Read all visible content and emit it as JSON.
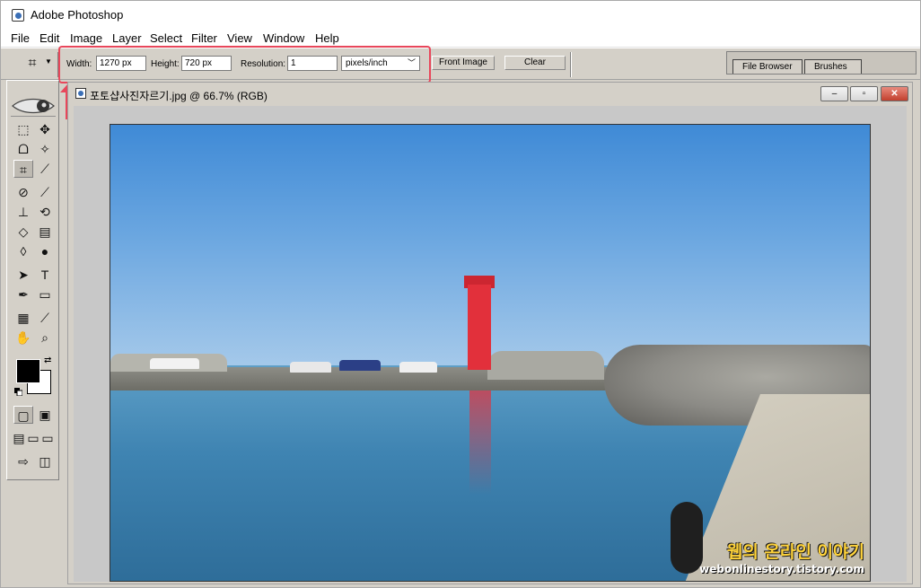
{
  "app": {
    "title": "Adobe Photoshop"
  },
  "menu": [
    "File",
    "Edit",
    "Image",
    "Layer",
    "Select",
    "Filter",
    "View",
    "Window",
    "Help"
  ],
  "options": {
    "width_label": "Width:",
    "width_value": "1270 px",
    "height_label": "Height:",
    "height_value": "720 px",
    "resolution_label": "Resolution:",
    "resolution_value": "1",
    "resolution_unit": "pixels/inch",
    "front_image_label": "Front Image",
    "clear_label": "Clear"
  },
  "palette_well": {
    "tabs": [
      "File Browser",
      "Brushes"
    ]
  },
  "document": {
    "title": "포토샵사진자르기.jpg @ 66.7% (RGB)"
  },
  "colors": {
    "accent_highlight": "#e8475b",
    "foreground": "#000000",
    "background": "#ffffff"
  },
  "watermark": {
    "title": "웹의 온라인 이야기",
    "url": "webonlinestory.tistory.com"
  }
}
